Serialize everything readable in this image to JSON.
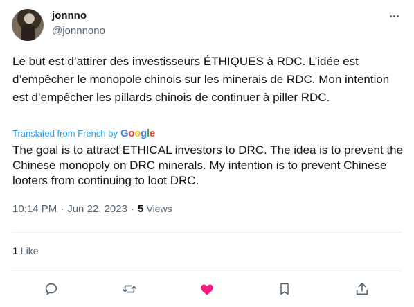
{
  "user": {
    "display_name": "jonnno",
    "handle": "@jonnnono"
  },
  "tweet": {
    "original_text": "Le but est d’attirer des investisseurs ÉTHIQUES à RDC. L’idée est d’empêcher le monopole chinois sur les minerais de RDC. Mon intention est d’empêcher les pillards chinois de continuer à piller RDC.",
    "translated_label": "Translated from French by",
    "translation_provider": "Google",
    "translated_text": "The goal is to attract ETHICAL investors to DRC. The idea is to prevent the Chinese monopoly on DRC minerals. My intention is to prevent Chinese looters from continuing to loot DRC.",
    "time": "10:14 PM",
    "date": "Jun 22, 2023",
    "separator": "·",
    "views_count": "5",
    "views_label": "Views"
  },
  "engagement": {
    "likes_count": "1",
    "likes_label": "Like"
  },
  "icons": {
    "more": "more-icon",
    "reply": "reply-icon",
    "retweet": "retweet-icon",
    "like": "like-icon",
    "bookmark": "bookmark-icon",
    "share": "share-icon"
  },
  "colors": {
    "like_active": "#f91880",
    "link_blue": "#1d9bf0",
    "secondary_text": "#536471"
  }
}
